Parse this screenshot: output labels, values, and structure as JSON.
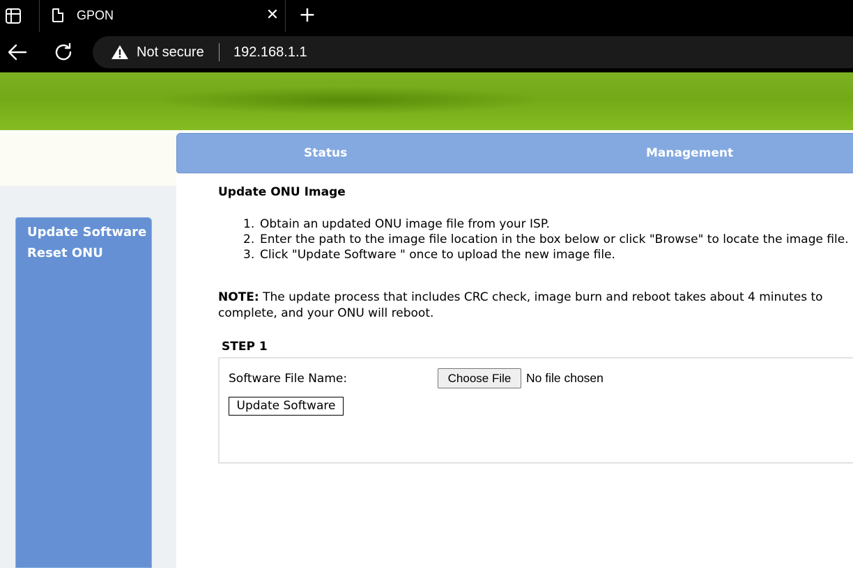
{
  "browser": {
    "tab_title": "GPON",
    "tab_close": "✕",
    "new_tab": "+",
    "security_label": "Not secure",
    "url": "192.168.1.1"
  },
  "nav": {
    "menu": [
      "Status",
      "Management"
    ],
    "sidebar": [
      "Update Software",
      "Reset ONU"
    ]
  },
  "main": {
    "title": "Update ONU Image",
    "steps": [
      {
        "num": "1.",
        "text": "Obtain an updated ONU image file from your ISP."
      },
      {
        "num": "2.",
        "text": "Enter the path to the image file location in the box below or click \"Browse\" to locate the image file."
      },
      {
        "num": "3.",
        "text": "Click \"Update Software \" once to upload the new image file."
      }
    ],
    "note_label": "NOTE:",
    "note_text": " The update process that includes CRC check, image burn and reboot takes about 4 minutes to complete, and your ONU will reboot.",
    "step_heading": "STEP 1",
    "field_label": "Software File Name:",
    "choose_file_label": "Choose File",
    "no_file_text": "No file chosen",
    "update_button_label": "Update Software"
  },
  "colors": {
    "banner_green": "#7cb123",
    "menubar_blue": "#84a9e0",
    "sidebar_blue": "#6591d4"
  }
}
